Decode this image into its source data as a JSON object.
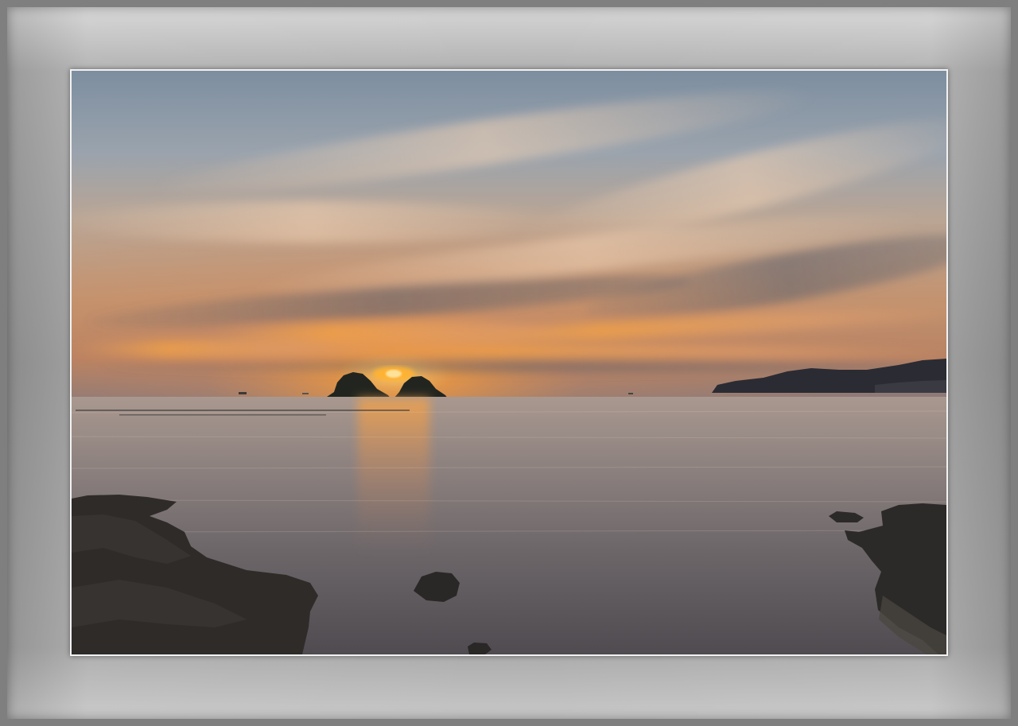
{
  "scene": {
    "subject": "coastal sunset",
    "colors": {
      "frame_outer": "#7f7f7f",
      "mat_light": "#d6d6d6",
      "mat_mid": "#9e9e9e",
      "photo_border": "#f2f2f2",
      "sky_top": "#6f8aa0",
      "sky_glow": "#f2a24a",
      "sun": "#ffb030",
      "water": "#6b6668",
      "rock": "#2a2725"
    }
  }
}
